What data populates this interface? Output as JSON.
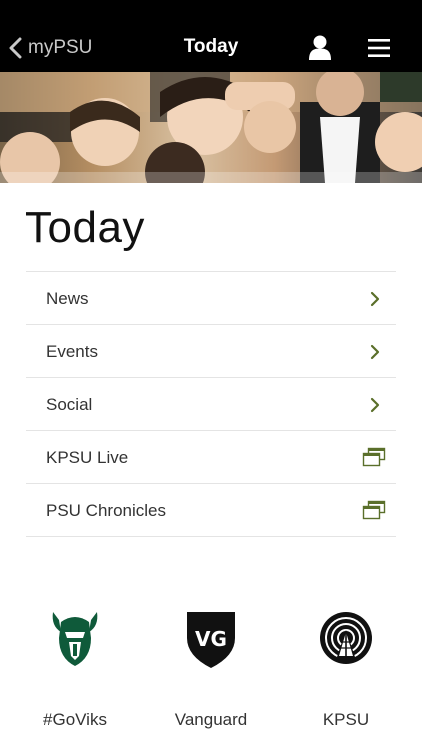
{
  "navbar": {
    "back_label": "myPSU",
    "title": "Today"
  },
  "page": {
    "heading": "Today"
  },
  "menu": {
    "items": [
      {
        "label": "News",
        "icon": "chevron-right-icon"
      },
      {
        "label": "Events",
        "icon": "chevron-right-icon"
      },
      {
        "label": "Social",
        "icon": "chevron-right-icon"
      },
      {
        "label": "KPSU Live",
        "icon": "external-window-icon"
      },
      {
        "label": "PSU Chronicles",
        "icon": "external-window-icon"
      }
    ]
  },
  "quick_links": [
    {
      "label": "#GoViks",
      "logo": "viking-logo"
    },
    {
      "label": "Vanguard",
      "logo": "vanguard-shield-logo",
      "logo_text": "VG"
    },
    {
      "label": "KPSU",
      "logo": "kpsu-radio-logo"
    }
  ],
  "colors": {
    "navbar_bg": "#000000",
    "accent": "#5a6f2a",
    "divider": "#e4e4e4",
    "viking_green": "#0f5a3a"
  }
}
